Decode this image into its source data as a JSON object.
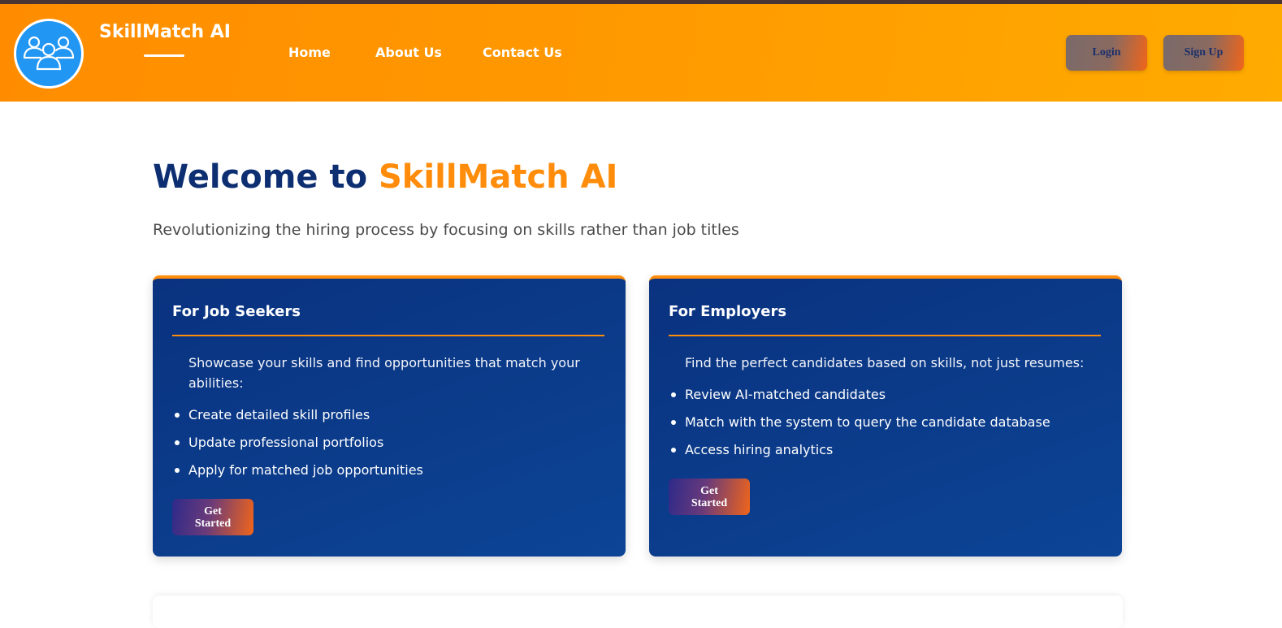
{
  "header": {
    "brand": "SkillMatch AI",
    "nav": [
      "Home",
      "About Us",
      "Contact Us"
    ],
    "login_label": "Login",
    "signup_label": "Sign Up"
  },
  "hero": {
    "title_prefix": "Welcome to",
    "title_accent": "SkillMatch AI",
    "subtitle": "Revolutionizing the hiring process by focusing on skills rather than job titles"
  },
  "cards": [
    {
      "title": "For Job Seekers",
      "intro": "Showcase your skills and find opportunities that match your abilities:",
      "items": [
        "Create detailed skill profiles",
        "Update professional portfolios",
        "Apply for matched job opportunities"
      ],
      "button_line1": "Get",
      "button_line2": "Started"
    },
    {
      "title": "For Employers",
      "intro": "Find the perfect candidates based on skills, not just resumes:",
      "items": [
        "Review AI-matched candidates",
        "Match with the system to query the candidate database",
        "Access hiring analytics"
      ],
      "button_line1": "Get",
      "button_line2": "Started"
    }
  ],
  "colors": {
    "header_orange": "#ff9a00",
    "navy": "#0d2f72",
    "accent_orange": "#ff8c0a",
    "logo_blue": "#2196f3"
  },
  "icons": {
    "logo": "users-group-icon"
  }
}
